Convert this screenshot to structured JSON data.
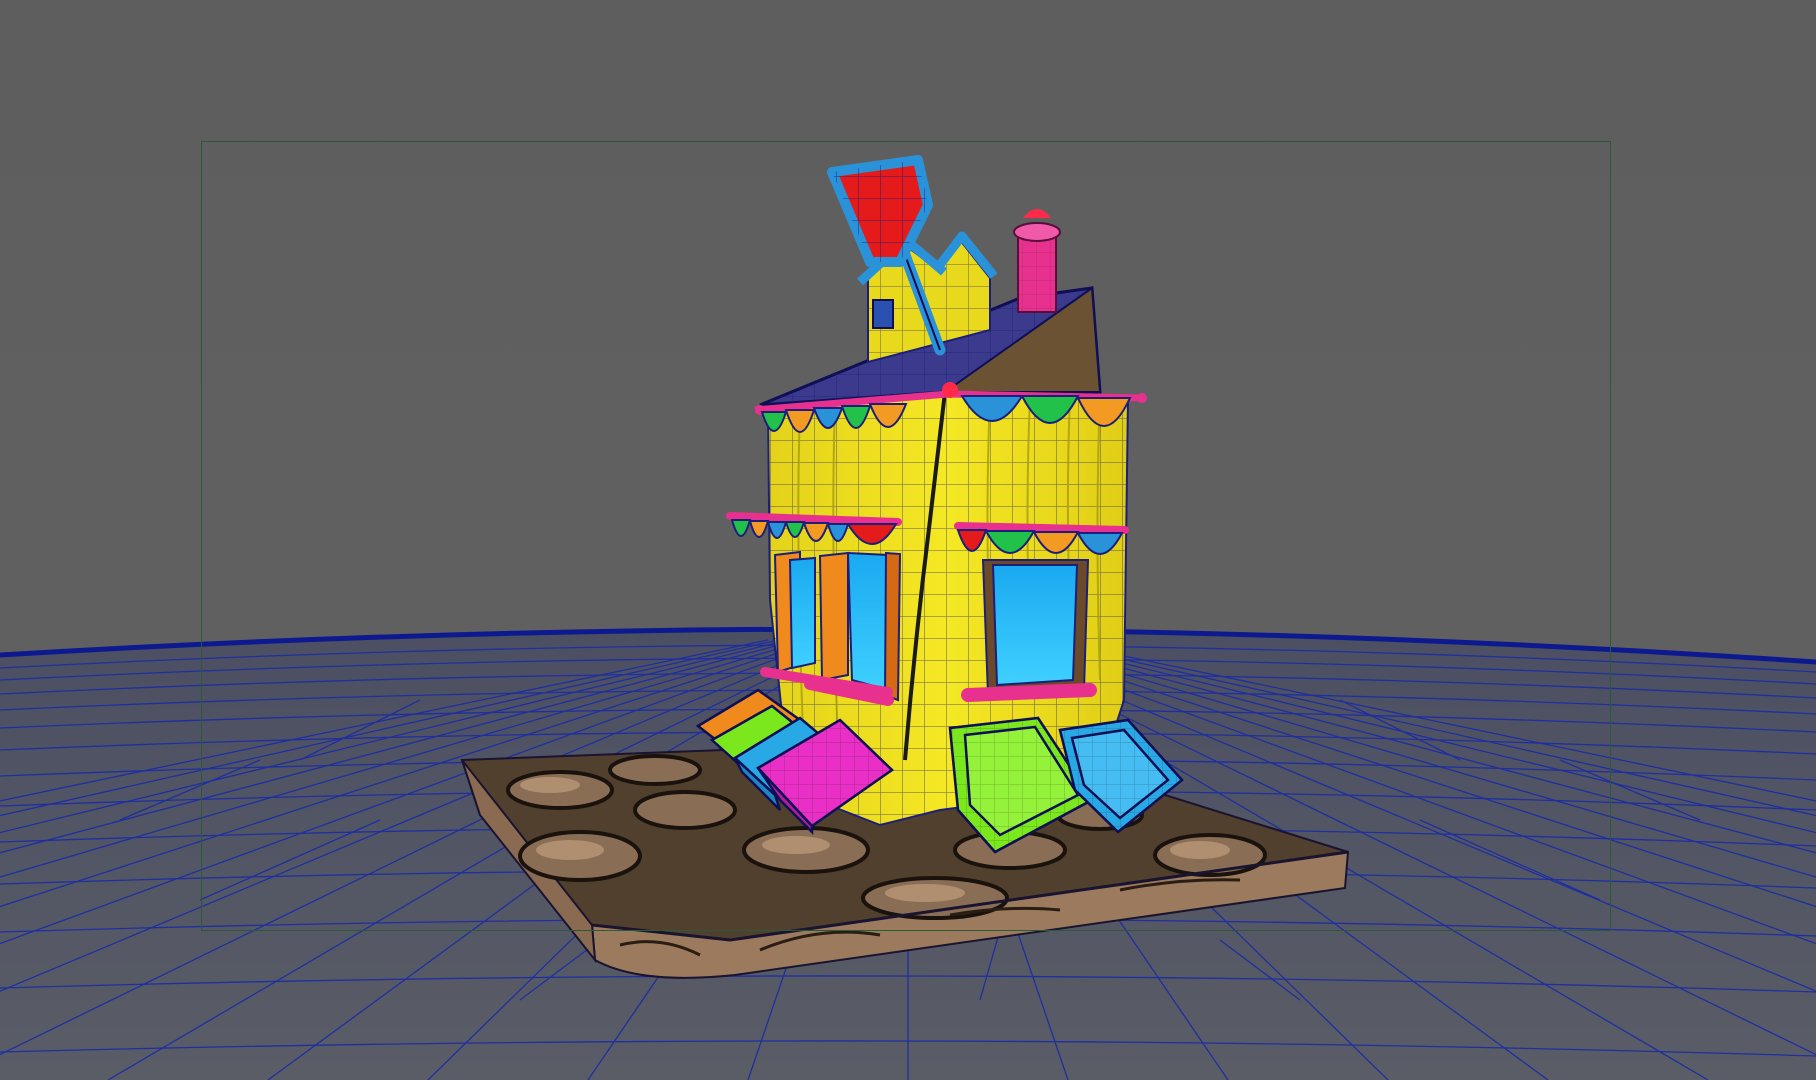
{
  "viewport": {
    "camera": "perspective",
    "shading": "textured-wireframe-on-shaded",
    "background_color": "#5f5f5f",
    "wireframe_color": "#1f2fa0",
    "resolution_gate_visible": true,
    "resolution_gate_color": "#2d5a36"
  },
  "scene": {
    "model": "stylized-house",
    "parts": [
      "ground-plane",
      "stone-base",
      "house-body",
      "roof",
      "dormer",
      "chimney",
      "sign",
      "bunting",
      "windows",
      "crates"
    ],
    "palette": {
      "body": "#f1e31a",
      "roof": "#3b3a8c",
      "sign": "#e51b1b",
      "window_glass": "#27c4f5",
      "chimney": "#e8318f",
      "crate_green": "#7be81d",
      "crate_blue": "#29a8e6",
      "crate_magenta": "#ea2fc7",
      "crate_orange": "#f08a1c",
      "base_stone": "#7a5f48"
    }
  }
}
